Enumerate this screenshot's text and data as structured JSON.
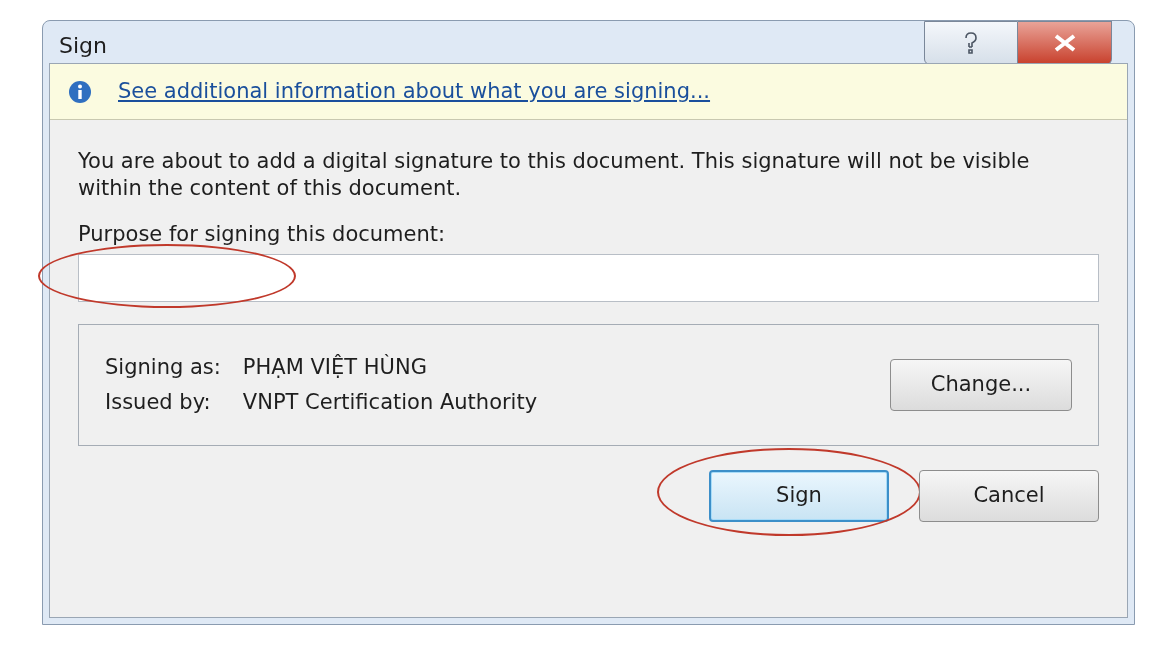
{
  "window": {
    "title": "Sign"
  },
  "info_bar": {
    "link": "See additional information about what you are signing..."
  },
  "message": "You are about to add a digital signature to this document. This signature will not be visible within the content of this document.",
  "purpose": {
    "label": "Purpose for signing this document:",
    "circled": true
  },
  "signer": {
    "rows": [
      {
        "label": "Signing as:",
        "value": "PHẠM VIỆT HÙNG"
      },
      {
        "label": "Issued by:",
        "value": "VNPT Certification Authority"
      }
    ],
    "button": "Change..."
  },
  "buttons": [
    {
      "label": "Sign",
      "default": true,
      "circled": true
    },
    {
      "label": "Cancel",
      "default": false,
      "circled": false
    }
  ]
}
